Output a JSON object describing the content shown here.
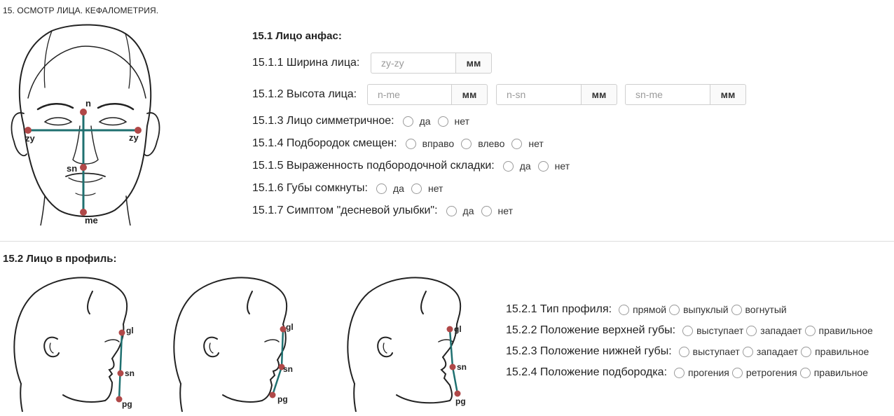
{
  "section_title": "15. ОСМОТР ЛИЦА. КЕФАЛОМЕТРИЯ.",
  "front": {
    "subtitle": "15.1 Лицо анфас:",
    "points": {
      "n": "n",
      "zy_left": "zy",
      "zy_right": "zy",
      "sn": "sn",
      "me": "me"
    },
    "width_row": {
      "label": "15.1.1 Ширина лица:",
      "placeholder": "zy-zy",
      "unit": "мм"
    },
    "height_row": {
      "label": "15.1.2 Высота лица:",
      "inputs": [
        {
          "placeholder": "n-me",
          "unit": "мм"
        },
        {
          "placeholder": "n-sn",
          "unit": "мм"
        },
        {
          "placeholder": "sn-me",
          "unit": "мм"
        }
      ]
    },
    "questions": [
      {
        "label": "15.1.3 Лицо симметричное:",
        "options": [
          "да",
          "нет"
        ]
      },
      {
        "label": "15.1.4 Подбородок смещен:",
        "options": [
          "вправо",
          "влево",
          "нет"
        ]
      },
      {
        "label": "15.1.5 Выраженность подбородочной складки:",
        "options": [
          "да",
          "нет"
        ]
      },
      {
        "label": "15.1.6 Губы сомкнуты:",
        "options": [
          "да",
          "нет"
        ]
      },
      {
        "label": "15.1.7 Симптом \"десневой улыбки\":",
        "options": [
          "да",
          "нет"
        ]
      }
    ]
  },
  "profile": {
    "subtitle": "15.2 Лицо в профиль:",
    "points": {
      "gl": "gl",
      "sn": "sn",
      "pg": "pg"
    },
    "questions": [
      {
        "label": "15.2.1 Тип профиля:",
        "options": [
          "прямой",
          "выпуклый",
          "вогнутый"
        ]
      },
      {
        "label": "15.2.2 Положение верхней губы:",
        "options": [
          "выступает",
          "западает",
          "правильное"
        ]
      },
      {
        "label": "15.2.3 Положение нижней губы:",
        "options": [
          "выступает",
          "западает",
          "правильное"
        ]
      },
      {
        "label": "15.2.4 Положение подбородка:",
        "options": [
          "прогения",
          "ретрогения",
          "правильное"
        ]
      }
    ]
  },
  "colors": {
    "line": "#1f7070",
    "point": "#b04848",
    "divider": "#dddddd"
  }
}
